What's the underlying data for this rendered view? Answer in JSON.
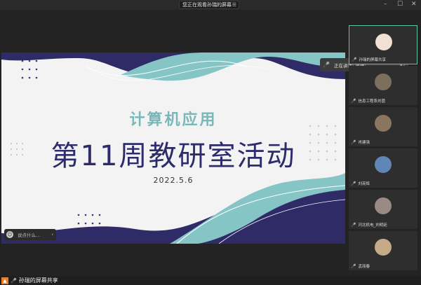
{
  "topbar": {
    "share_text": "您正在观看孙瑞的屏幕",
    "menu_icon": "menu-icon",
    "window_controls": [
      "minimize-icon",
      "maximize-icon",
      "close-icon"
    ]
  },
  "slide": {
    "subtitle": "计算机应用",
    "title": "第11周教研室活动",
    "date": "2022.5.6",
    "colors": {
      "navy": "#2e2b6a",
      "teal": "#79b8b9",
      "background": "#f3f3f4"
    }
  },
  "chat": {
    "placeholder": "说点什么..."
  },
  "speaking": {
    "text": "正在讲话: 孙瑞;"
  },
  "participants": [
    {
      "name": "孙瑞的屏幕共享",
      "avatar_color": "#f2e0d4",
      "active": true
    },
    {
      "name": "信息工程系刘茵",
      "avatar_color": "#7d6f5e"
    },
    {
      "name": "肖建强",
      "avatar_color": "#8a7660"
    },
    {
      "name": "刘亮辉",
      "avatar_color": "#5f86b7"
    },
    {
      "name": "河北机电_刘明廷",
      "avatar_color": "#9a8a86"
    },
    {
      "name": "孟丽春",
      "avatar_color": "#c5aa88"
    }
  ],
  "bottom": {
    "label": "孙瑞的屏幕共享"
  }
}
